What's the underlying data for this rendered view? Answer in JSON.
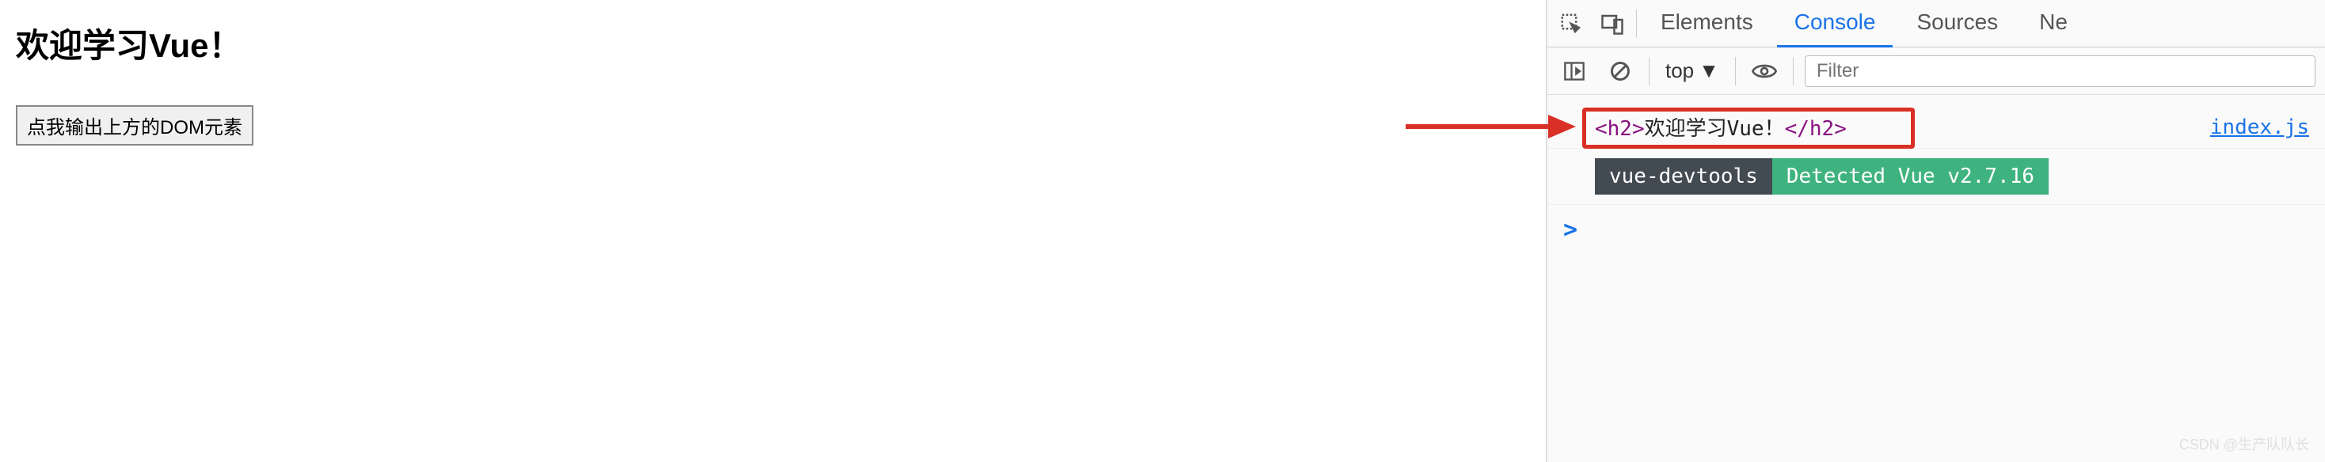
{
  "page": {
    "heading": "欢迎学习Vue！",
    "button_label": "点我输出上方的DOM元素"
  },
  "devtools": {
    "tabs": {
      "elements": "Elements",
      "console": "Console",
      "sources": "Sources",
      "next_partial": "Ne"
    },
    "toolbar": {
      "context": "top",
      "filter_placeholder": "Filter"
    },
    "console": {
      "log_open_tag": "<h2>",
      "log_text": "欢迎学习Vue！",
      "log_close_tag": "</h2>",
      "source_link": "index.js",
      "badge_tool": "vue-devtools",
      "badge_detected": "Detected Vue v2.7.16",
      "prompt": ">"
    }
  },
  "watermark": "CSDN @生产队队长"
}
